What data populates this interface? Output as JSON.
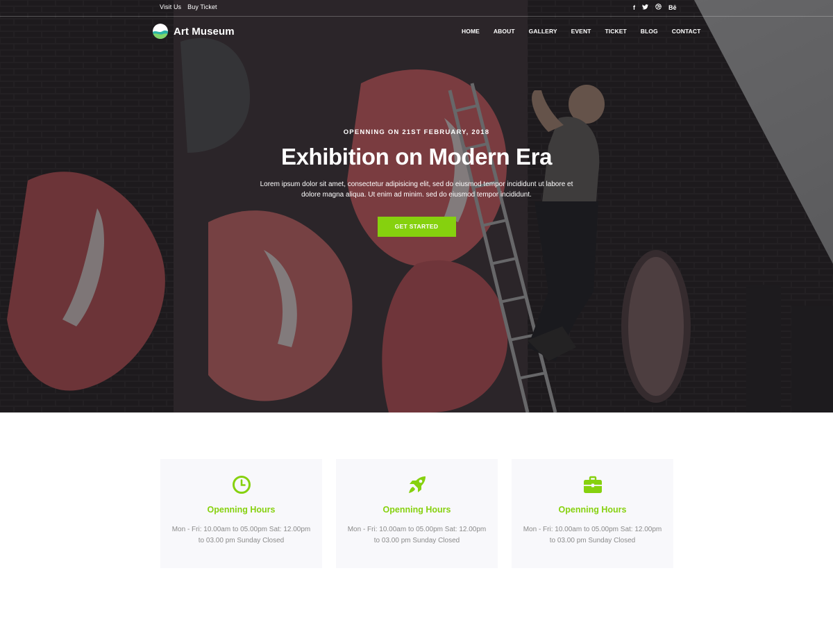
{
  "topbar": {
    "links": [
      "Visit Us",
      "Buy Ticket"
    ],
    "social": [
      "f",
      "t",
      "d",
      "Bē"
    ]
  },
  "brand": {
    "name": "Art Museum"
  },
  "nav": {
    "items": [
      "HOME",
      "ABOUT",
      "GALLERY",
      "EVENT",
      "TICKET",
      "BLOG",
      "CONTACT"
    ]
  },
  "hero": {
    "subtitle": "OPENNING ON 21ST FEBRUARY, 2018",
    "title": "Exhibition on Modern Era",
    "description_line1": "Lorem ipsum dolor sit amet, consectetur adipisicing elit, sed do eiusmod tempor incididunt ut labore et",
    "description_line2": "dolore magna aliqua. Ut enim ad minim. sed do eiusmod tempor incididunt.",
    "cta_label": "GET STARTED"
  },
  "features": [
    {
      "icon": "clock-icon",
      "title": "Openning Hours",
      "text_line1": "Mon - Fri: 10.00am to 05.00pm Sat: 12.00pm",
      "text_line2": "to 03.00 pm Sunday Closed"
    },
    {
      "icon": "rocket-icon",
      "title": "Openning Hours",
      "text_line1": "Mon - Fri: 10.00am to 05.00pm Sat: 12.00pm",
      "text_line2": "to 03.00 pm Sunday Closed"
    },
    {
      "icon": "briefcase-icon",
      "title": "Openning Hours",
      "text_line1": "Mon - Fri: 10.00am to 05.00pm Sat: 12.00pm",
      "text_line2": "to 03.00 pm Sunday Closed"
    }
  ],
  "colors": {
    "accent": "#86d10e",
    "card_bg": "#f8f8fb",
    "body_text": "#8a8a8a"
  }
}
